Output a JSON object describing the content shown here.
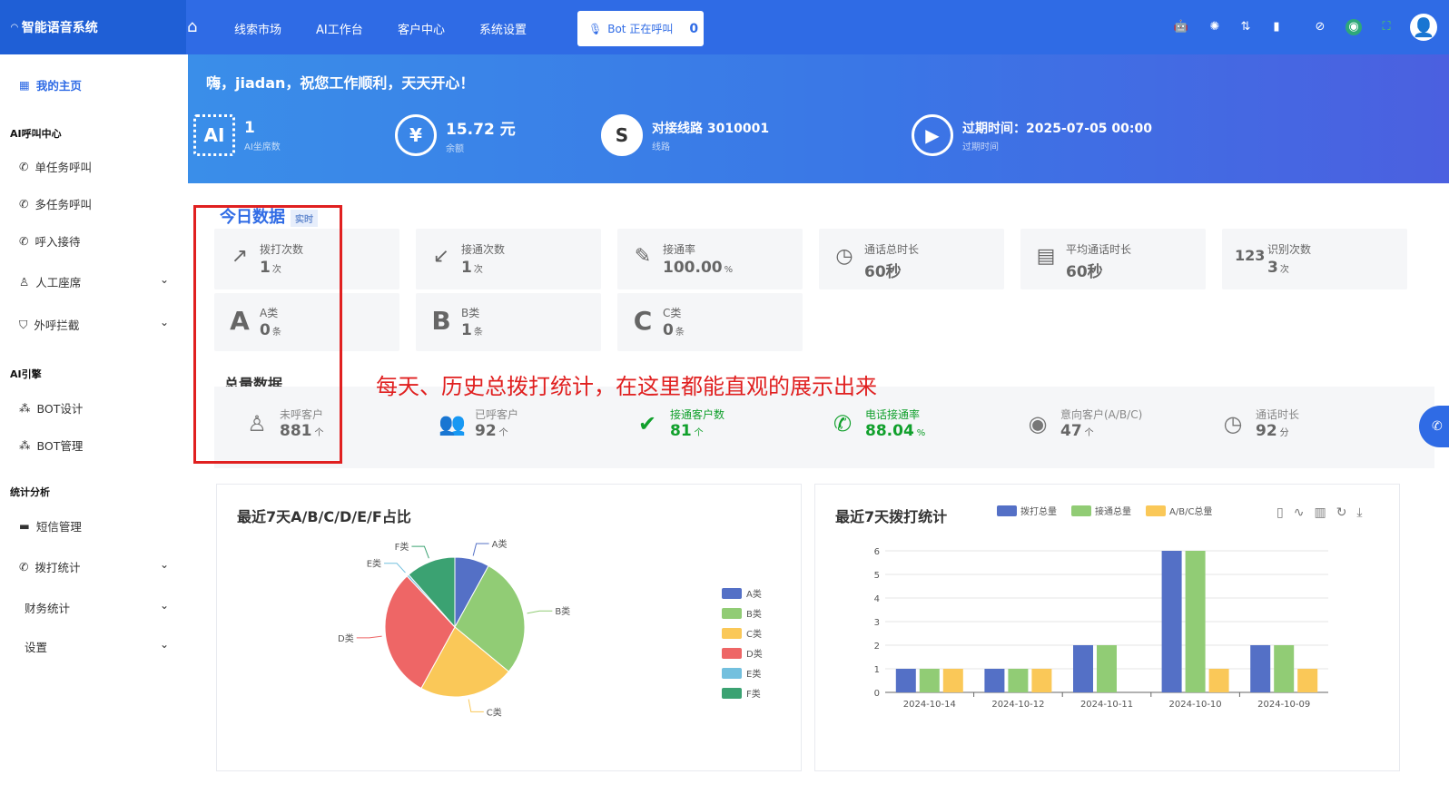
{
  "app": {
    "brand": "智能语音系统"
  },
  "topnav": {
    "items": [
      "线索市场",
      "AI工作台",
      "客户中心",
      "系统设置"
    ],
    "bot_label": "Bot 正在呼叫",
    "bot_count": "0"
  },
  "sidebar": {
    "home": "我的主页",
    "h_ai_call": "AI呼叫中心",
    "single_task": "单任务呼叫",
    "multi_task": "多任务呼叫",
    "inbound": "呼入接待",
    "human_seat": "人工座席",
    "outbound_block": "外呼拦截",
    "h_ai_engine": "AI引擎",
    "bot_design": "BOT设计",
    "bot_manage": "BOT管理",
    "h_stats": "统计分析",
    "sms_manage": "短信管理",
    "call_stats": "拨打统计",
    "finance_stats": "财务统计",
    "settings": "设置"
  },
  "hero": {
    "greeting": "嗨，jiadan，祝您工作顺利，天天开心！",
    "seats_value": "1",
    "seats_label": "AI坐席数",
    "balance_value": "15.72 元",
    "balance_label": "余额",
    "line_value": "对接线路 3010001",
    "line_label": "线路",
    "expire_value_prefix": "过期时间：",
    "expire_value": "2025-07-05 00:00",
    "expire_label": "过期时间"
  },
  "today": {
    "title": "今日数据",
    "realtime": "实时",
    "cards": [
      {
        "label": "拨打次数",
        "value": "1",
        "unit": "次"
      },
      {
        "label": "接通次数",
        "value": "1",
        "unit": "次"
      },
      {
        "label": "接通率",
        "value": "100.00",
        "unit": "%"
      },
      {
        "label": "通话总时长",
        "value": "60秒",
        "unit": ""
      },
      {
        "label": "平均通话时长",
        "value": "60秒",
        "unit": ""
      },
      {
        "label": "识别次数",
        "value": "3",
        "unit": "次"
      },
      {
        "label": "A类",
        "value": "0",
        "unit": "条"
      },
      {
        "label": "B类",
        "value": "1",
        "unit": "条"
      },
      {
        "label": "C类",
        "value": "0",
        "unit": "条"
      }
    ]
  },
  "total": {
    "title": "总量数据",
    "items": [
      {
        "label": "未呼客户",
        "value": "881",
        "unit": "个"
      },
      {
        "label": "已呼客户",
        "value": "92",
        "unit": "个"
      },
      {
        "label": "接通客户数",
        "value": "81",
        "unit": "个"
      },
      {
        "label": "电话接通率",
        "value": "88.04",
        "unit": "%"
      },
      {
        "label": "意向客户(A/B/C)",
        "value": "47",
        "unit": "个"
      },
      {
        "label": "通话时长",
        "value": "92",
        "unit": "分"
      }
    ]
  },
  "annotation": "每天、历史总拨打统计，在这里都能直观的展示出来",
  "colors": {
    "primary": "#2f6be5",
    "green": "#11a02c",
    "red": "#e02020"
  },
  "chart_data": [
    {
      "type": "pie",
      "title": "最近7天A/B/C/D/E/F占比",
      "categories": [
        "A类",
        "B类",
        "C类",
        "D类",
        "E类",
        "F类"
      ],
      "values": [
        8,
        28,
        22,
        30,
        0.5,
        11.5
      ],
      "colors": [
        "#5470c6",
        "#91cc75",
        "#fac858",
        "#ee6666",
        "#73c0de",
        "#3ba272"
      ],
      "legend": "right"
    },
    {
      "type": "bar",
      "title": "最近7天拨打统计",
      "categories": [
        "2024-10-14",
        "2024-10-12",
        "2024-10-11",
        "2024-10-10",
        "2024-10-09"
      ],
      "series": [
        {
          "name": "拨打总量",
          "values": [
            1,
            1,
            2,
            6,
            2
          ],
          "color": "#5470c6"
        },
        {
          "name": "接通总量",
          "values": [
            1,
            1,
            2,
            6,
            2
          ],
          "color": "#91cc75"
        },
        {
          "name": "A/B/C总量",
          "values": [
            1,
            1,
            0,
            1,
            1
          ],
          "color": "#fac858"
        }
      ],
      "ylim": [
        0,
        6
      ],
      "yticks": [
        0,
        1,
        2,
        3,
        4,
        5,
        6
      ],
      "legend": "top"
    }
  ]
}
